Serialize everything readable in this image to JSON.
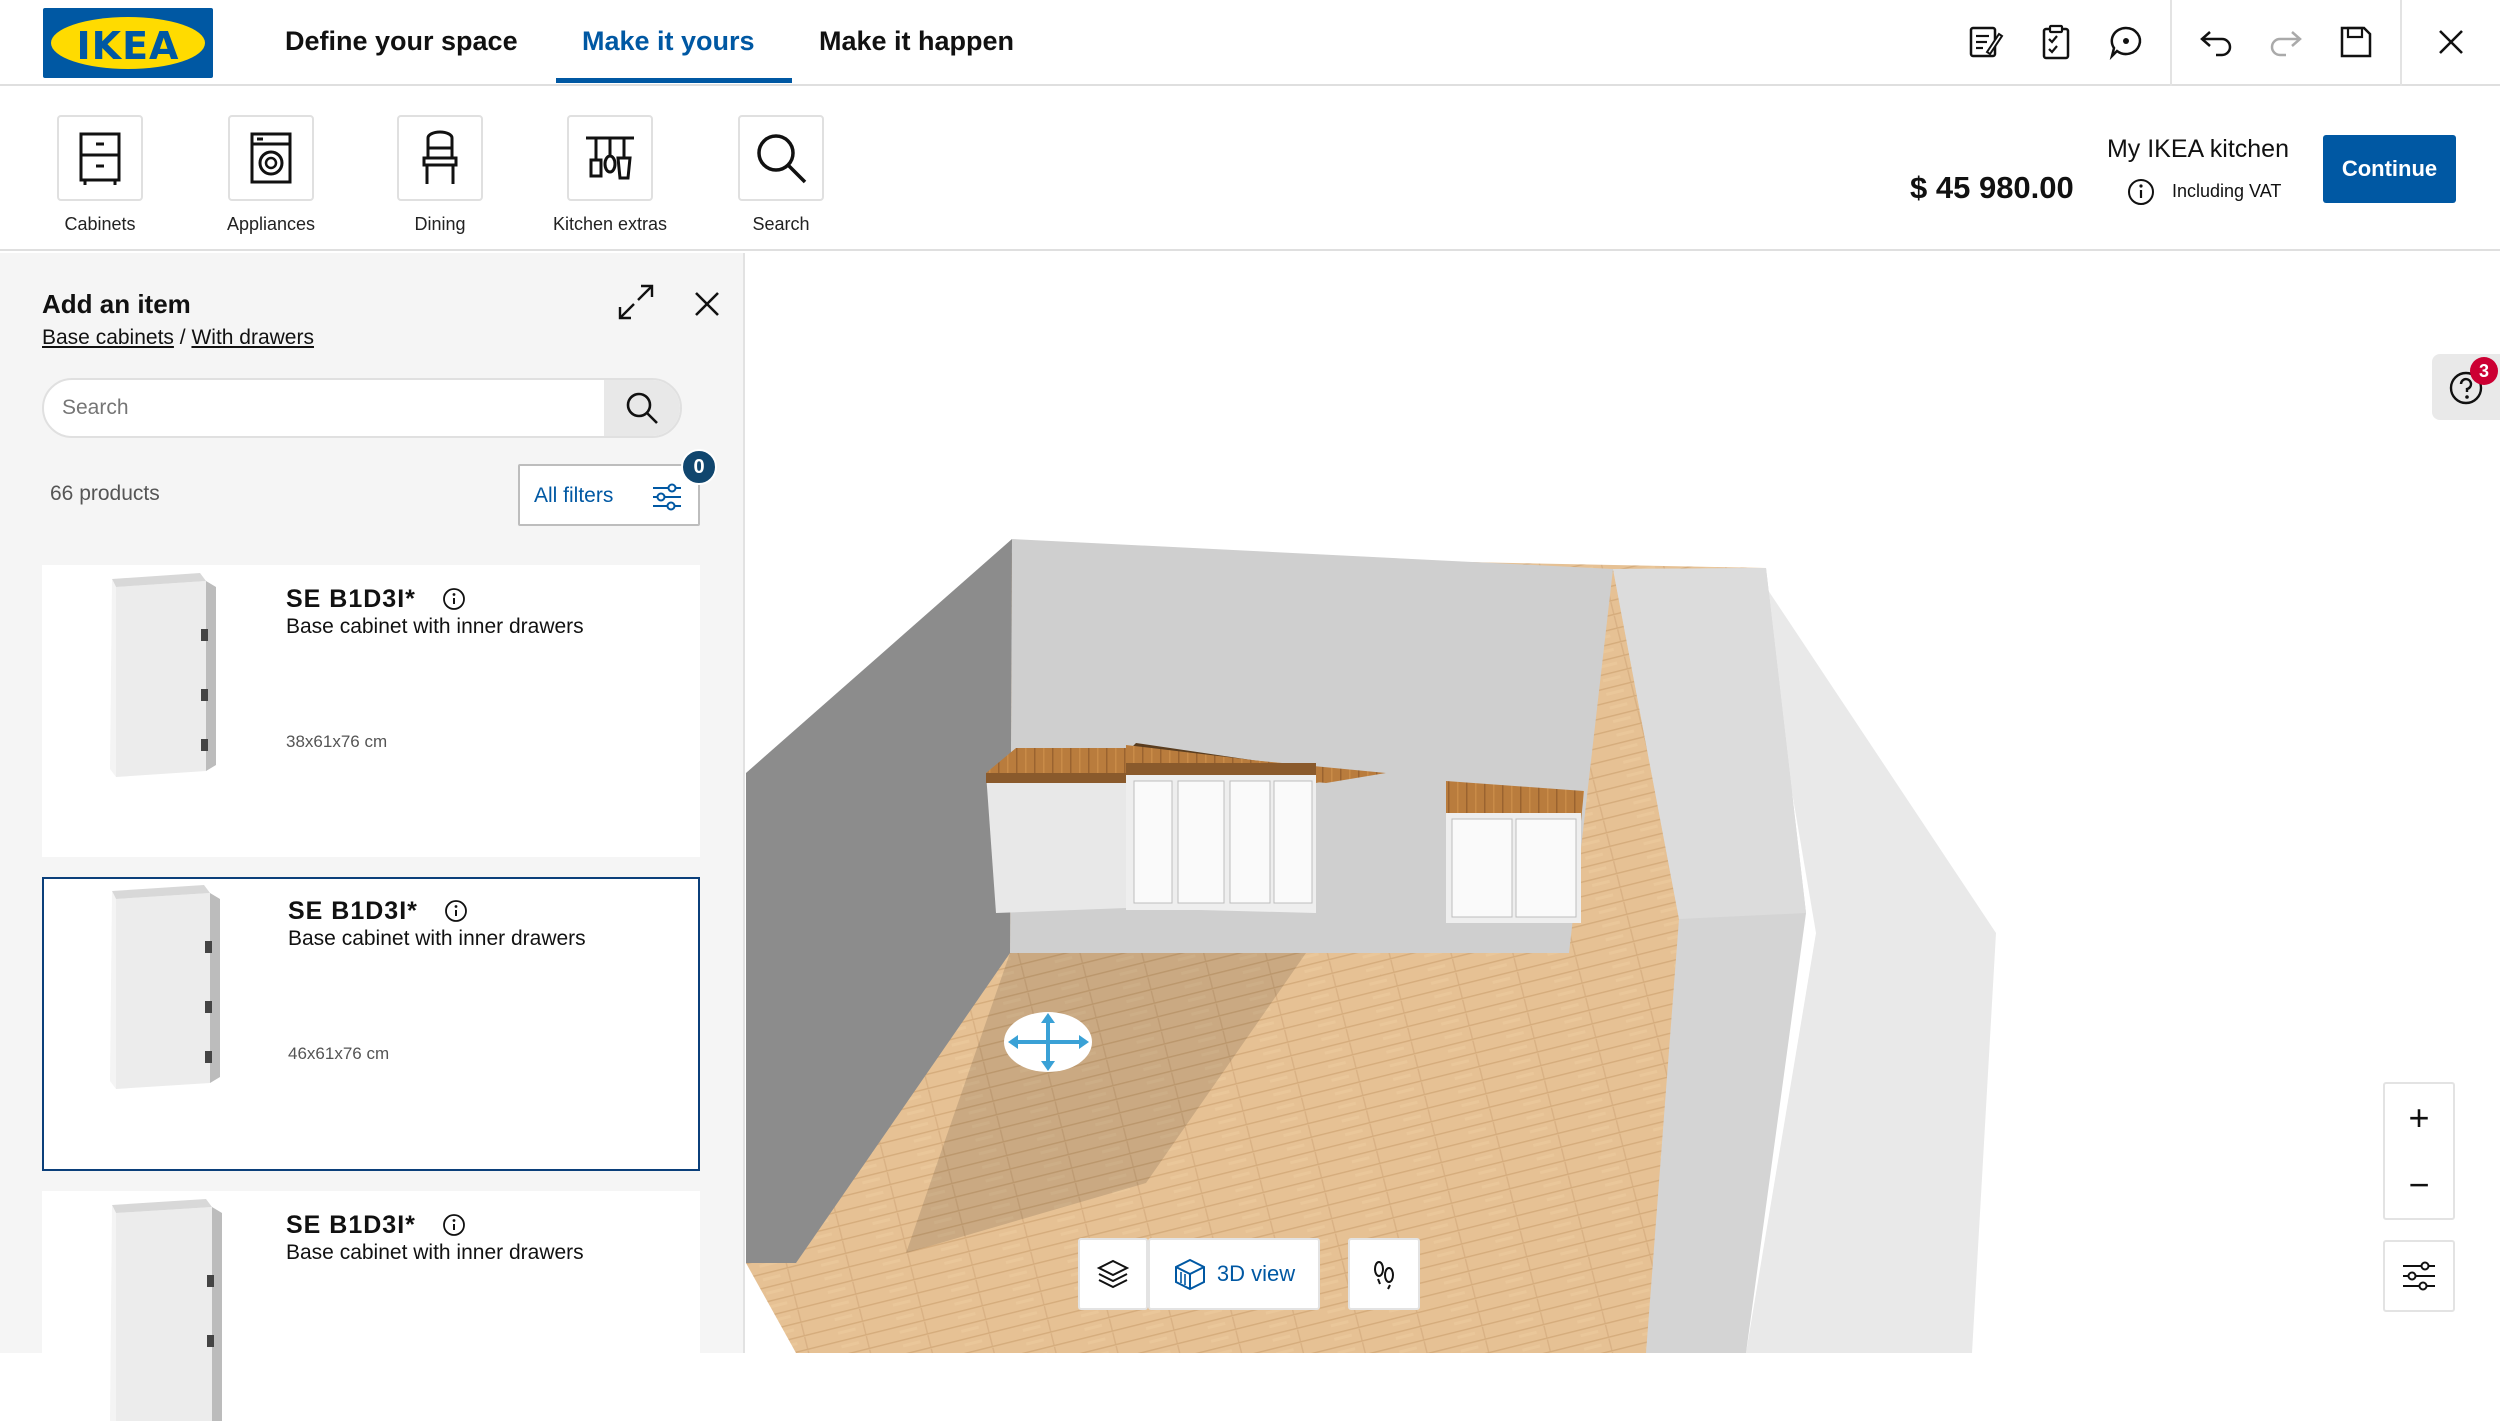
{
  "header": {
    "logo_text": "IKEA",
    "tabs": [
      {
        "label": "Define your space",
        "active": false
      },
      {
        "label": "Make it yours",
        "active": true
      },
      {
        "label": "Make it happen",
        "active": false
      }
    ],
    "toolbar_icons": [
      "notes-icon",
      "checklist-icon",
      "chat-icon",
      "undo-icon",
      "redo-icon",
      "save-icon",
      "close-icon"
    ],
    "accent_color": "#0058a3"
  },
  "categories": [
    {
      "label": "Cabinets",
      "icon": "cabinet-icon"
    },
    {
      "label": "Appliances",
      "icon": "washing-machine-icon"
    },
    {
      "label": "Dining",
      "icon": "chair-icon"
    },
    {
      "label": "Kitchen extras",
      "icon": "kitchen-utensils-icon"
    },
    {
      "label": "Search",
      "icon": "search-icon"
    }
  ],
  "summary": {
    "kitchen_name": "My IKEA kitchen",
    "price": "$ 45 980.00",
    "vat_note": "Including VAT",
    "continue_label": "Continue"
  },
  "panel": {
    "title": "Add an item",
    "breadcrumb": [
      "Base cabinets",
      "With drawers"
    ],
    "breadcrumb_sep": "/",
    "search_placeholder": "Search",
    "product_count": "66 products",
    "filters_label": "All filters",
    "filters_count": "0"
  },
  "products": [
    {
      "name": "SE B1D3I*",
      "desc": "Base cabinet with inner drawers",
      "dims": "38x61x76 cm",
      "selected": false
    },
    {
      "name": "SE B1D3I*",
      "desc": "Base cabinet with inner drawers",
      "dims": "46x61x76 cm",
      "selected": true
    },
    {
      "name": "SE B1D3I*",
      "desc": "Base cabinet with inner drawers",
      "dims": "",
      "selected": false
    }
  ],
  "viewport": {
    "view_mode_label": "3D view",
    "help_badge_count": "3",
    "zoom_in": "+",
    "zoom_out": "−"
  }
}
